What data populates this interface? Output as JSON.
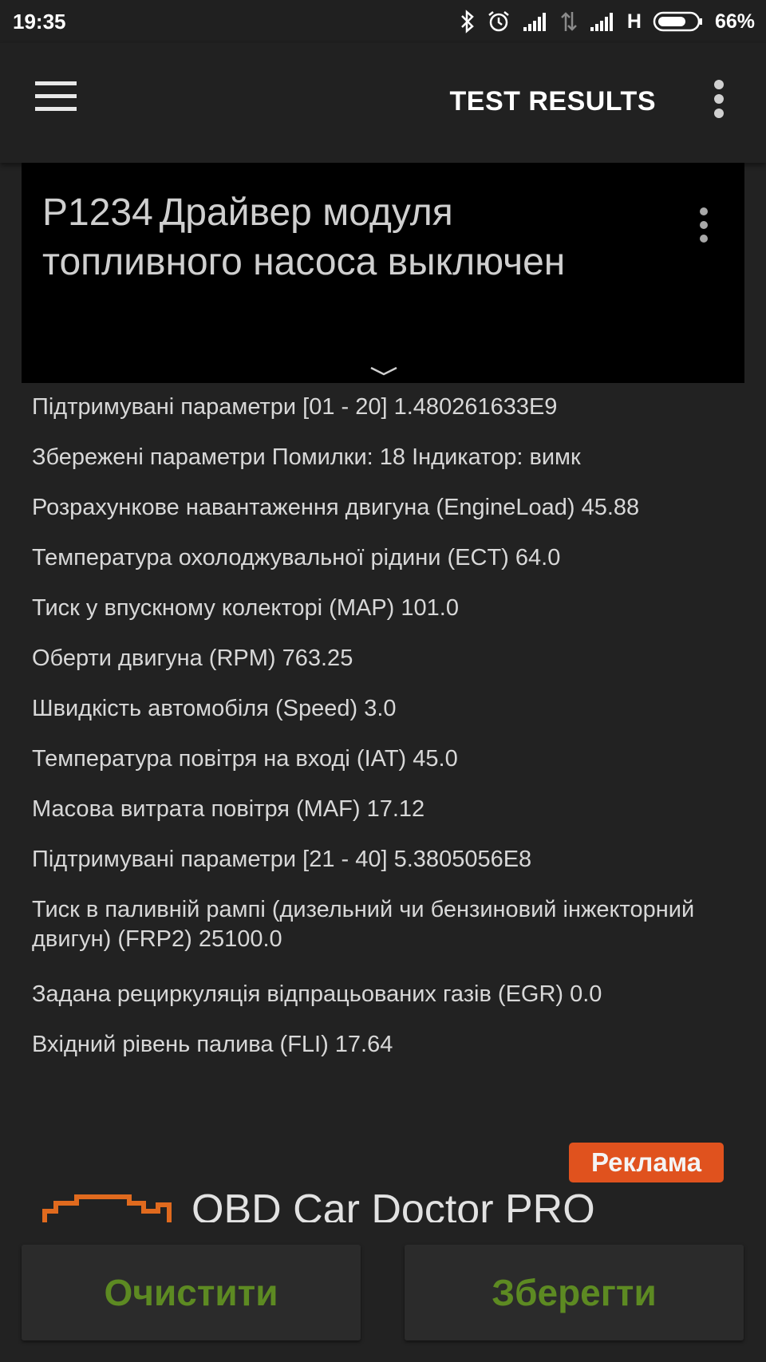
{
  "status_bar": {
    "time": "19:35",
    "network_type": "H",
    "battery": "66%"
  },
  "app_bar": {
    "title": "TEST RESULTS",
    "menu_icon": "hamburger-menu-icon",
    "overflow_icon": "more-vert-icon"
  },
  "code_card": {
    "code": "P1234",
    "description": "Драйвер модуля топливного насоса выключен",
    "overflow_icon": "more-vert-icon",
    "expand_icon": "chevron-down-icon"
  },
  "parameters": [
    "Підтримувані параметри [01 - 20] 1.480261633E9",
    "Збережені параметри Помилки: 18 Індикатор: вимк",
    "Розрахункове навантаження двигуна (EngineLoad) 45.88",
    "Температура охолоджувальної рідини (ECT) 64.0",
    "Тиск у впускному колекторі (MAP) 101.0",
    "Оберти двигуна (RPM) 763.25",
    "Швидкість автомобіля (Speed) 3.0",
    "Температура повітря на вході (IAT) 45.0",
    "Масова витрата повітря (MAF) 17.12",
    "Підтримувані параметри [21 - 40] 5.3805056E8",
    "Тиск в паливній рампі (дизельний чи бензиновий інжекторний двигун) (FRP2) 25100.0",
    "Задана рециркуляція відпрацьованих газів (EGR) 0.0",
    "Вхідний рівень палива (FLI) 17.64"
  ],
  "ad": {
    "badge": "Реклама",
    "title": "OBD Car Doctor PRO",
    "badge_color": "#e0521e"
  },
  "buttons": {
    "clear": "Очистити",
    "save": "Зберегти",
    "text_color": "#5d8a22"
  }
}
